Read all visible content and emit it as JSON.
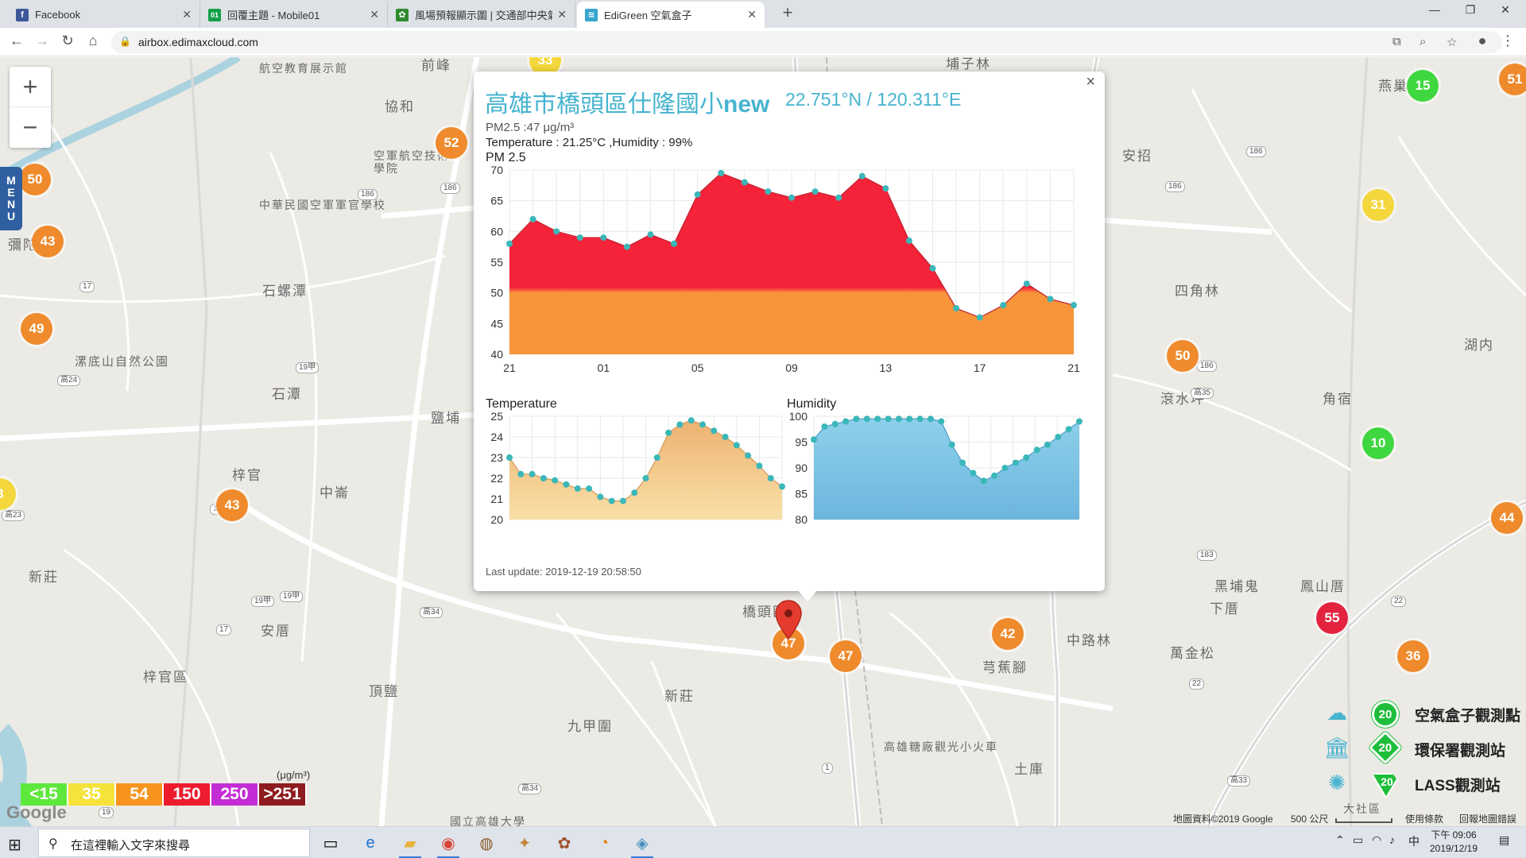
{
  "browser": {
    "tabs": [
      {
        "title": "Facebook",
        "favicon": "facebook-icon",
        "color": "#3b5998",
        "glyph": "f",
        "active": false
      },
      {
        "title": "回覆主題 - Mobile01",
        "favicon": "mobile01-icon",
        "color": "#14a04a",
        "glyph": "01",
        "active": false
      },
      {
        "title": "風場預報顯示圖 | 交通部中央氣象局",
        "favicon": "cwb-icon",
        "color": "#2e8b2e",
        "glyph": "✿",
        "active": false
      },
      {
        "title": "EdiGreen 空氣盒子",
        "favicon": "edigreen-icon",
        "color": "#36a5cf",
        "glyph": "≋",
        "active": true
      }
    ],
    "url": "airbox.edimaxcloud.com"
  },
  "map": {
    "zoom_in": "+",
    "zoom_out": "−",
    "menu_label": "MENU",
    "place_labels": [
      "航空教育展示館",
      "前峰",
      "協和",
      "空軍航空技術學院",
      "中華民國空軍軍官學校",
      "石螺潭",
      "漯底山自然公園",
      "石潭",
      "鹽埔",
      "梓官",
      "中崙",
      "新莊",
      "安厝",
      "梓官區",
      "頂鹽",
      "九甲圍",
      "新莊",
      "橋頭區",
      "芎蕉腳",
      "中路林",
      "萬金松",
      "黑埔鬼",
      "鳳山厝",
      "下厝",
      "土庫",
      "高雄糖廠觀光小火車",
      "安招",
      "四角林",
      "滾水坪",
      "角宿",
      "湖内",
      "燕巢",
      "埔子林",
      "大社區",
      "國立高雄大學",
      "彌陀"
    ],
    "markers": [
      {
        "value": "33",
        "level": "yellow"
      },
      {
        "value": "52",
        "level": "orange"
      },
      {
        "value": "50",
        "level": "orange"
      },
      {
        "value": "43",
        "level": "orange"
      },
      {
        "value": "49",
        "level": "orange"
      },
      {
        "value": "43",
        "level": "orange"
      },
      {
        "value": "3",
        "level": "yellow"
      },
      {
        "value": "47",
        "level": "orange"
      },
      {
        "value": "47",
        "level": "orange"
      },
      {
        "value": "42",
        "level": "orange"
      },
      {
        "value": "50",
        "level": "orange"
      },
      {
        "value": "15",
        "level": "green"
      },
      {
        "value": "51",
        "level": "orange"
      },
      {
        "value": "31",
        "level": "yellow"
      },
      {
        "value": "10",
        "level": "green"
      },
      {
        "value": "44",
        "level": "orange"
      },
      {
        "value": "55",
        "level": "red"
      },
      {
        "value": "36",
        "level": "orange"
      }
    ],
    "road_shields": [
      "186",
      "186",
      "186",
      "186",
      "186",
      "183",
      "17",
      "19甲",
      "19甲",
      "19甲",
      "19甲",
      "19",
      "1",
      "22",
      "22",
      "高24",
      "高23",
      "高35",
      "高34",
      "高34",
      "高33",
      "17"
    ]
  },
  "popup": {
    "close": "×",
    "title": "高雄市橋頭區仕隆國小",
    "title_suffix": "new",
    "coords": "22.751°N / 120.311°E",
    "pm25_line": "PM2.5 :47 μg/m³",
    "temp_line": "Temperature : 21.25°C ,Humidity : 99%",
    "last_update": "Last update: 2019-12-19 20:58:50"
  },
  "chart_data": [
    {
      "type": "area",
      "title": "PM 2.5",
      "x_ticks": [
        "21",
        "01",
        "05",
        "09",
        "13",
        "17",
        "21"
      ],
      "ylim": [
        40,
        70
      ],
      "y_ticks": [
        40,
        45,
        50,
        55,
        60,
        65,
        70
      ],
      "grid": true,
      "threshold": 50,
      "colors": {
        "above": "#f52339",
        "below": "#f8953a",
        "point": "#3ab7b9"
      },
      "values": [
        58,
        62,
        60,
        59,
        59,
        57.5,
        59.5,
        58,
        66,
        69.5,
        68,
        66.5,
        65.5,
        66.5,
        65.5,
        69,
        67,
        58.5,
        54,
        47.5,
        46,
        48,
        51.5,
        49,
        48
      ]
    },
    {
      "type": "area",
      "title": "Temperature",
      "ylim": [
        20,
        25
      ],
      "y_ticks": [
        20,
        21,
        22,
        23,
        24,
        25
      ],
      "grid": true,
      "colors": {
        "fill_top": "#edb271",
        "fill_bottom": "#f9e0a8",
        "point": "#3ab7b9"
      },
      "values": [
        23.0,
        22.2,
        22.2,
        22.0,
        21.9,
        21.7,
        21.5,
        21.5,
        21.1,
        20.9,
        20.9,
        21.3,
        22.0,
        23.0,
        24.2,
        24.6,
        24.8,
        24.6,
        24.3,
        24.0,
        23.6,
        23.1,
        22.6,
        22.0,
        21.6
      ]
    },
    {
      "type": "area",
      "title": "Humidity",
      "ylim": [
        80,
        100
      ],
      "y_ticks": [
        80,
        85,
        90,
        95,
        100
      ],
      "grid": true,
      "colors": {
        "fill_top": "#8dd0ea",
        "fill_bottom": "#6cb5dd",
        "point": "#3ab7b9"
      },
      "values": [
        95.5,
        98,
        98.5,
        99,
        99.5,
        99.5,
        99.5,
        99.5,
        99.5,
        99.5,
        99.5,
        99.5,
        99,
        94.5,
        91,
        89,
        87.5,
        88.5,
        90,
        91,
        92,
        93.5,
        94.5,
        96,
        97.5,
        99
      ]
    }
  ],
  "aqi_scale": {
    "unit": "(μg/m³)",
    "cells": [
      {
        "label": "<15",
        "color": "#5ee83d"
      },
      {
        "label": "35",
        "color": "#f5e33b"
      },
      {
        "label": "54",
        "color": "#f7941d"
      },
      {
        "label": "150",
        "color": "#ec1c2e"
      },
      {
        "label": "250",
        "color": "#c42dd6"
      },
      {
        "label": ">251",
        "color": "#8e1b1f"
      }
    ]
  },
  "station_legend": [
    {
      "label": "空氣盒子觀測點",
      "count": "20",
      "icon": "airbox-icon"
    },
    {
      "label": "環保署觀測站",
      "count": "20",
      "icon": "epa-building-icon"
    },
    {
      "label": "LASS觀測站",
      "count": "20",
      "icon": "lass-icon"
    }
  ],
  "attribution": {
    "google_logo": "Google",
    "map_data": "地圖資料©2019 Google",
    "scale": "500 公尺",
    "terms": "使用條款",
    "report": "回報地圖錯誤"
  },
  "taskbar": {
    "search_placeholder": "在這裡輸入文字來搜尋",
    "time": "下午 09:06",
    "date": "2019/12/19",
    "ime": "中"
  }
}
